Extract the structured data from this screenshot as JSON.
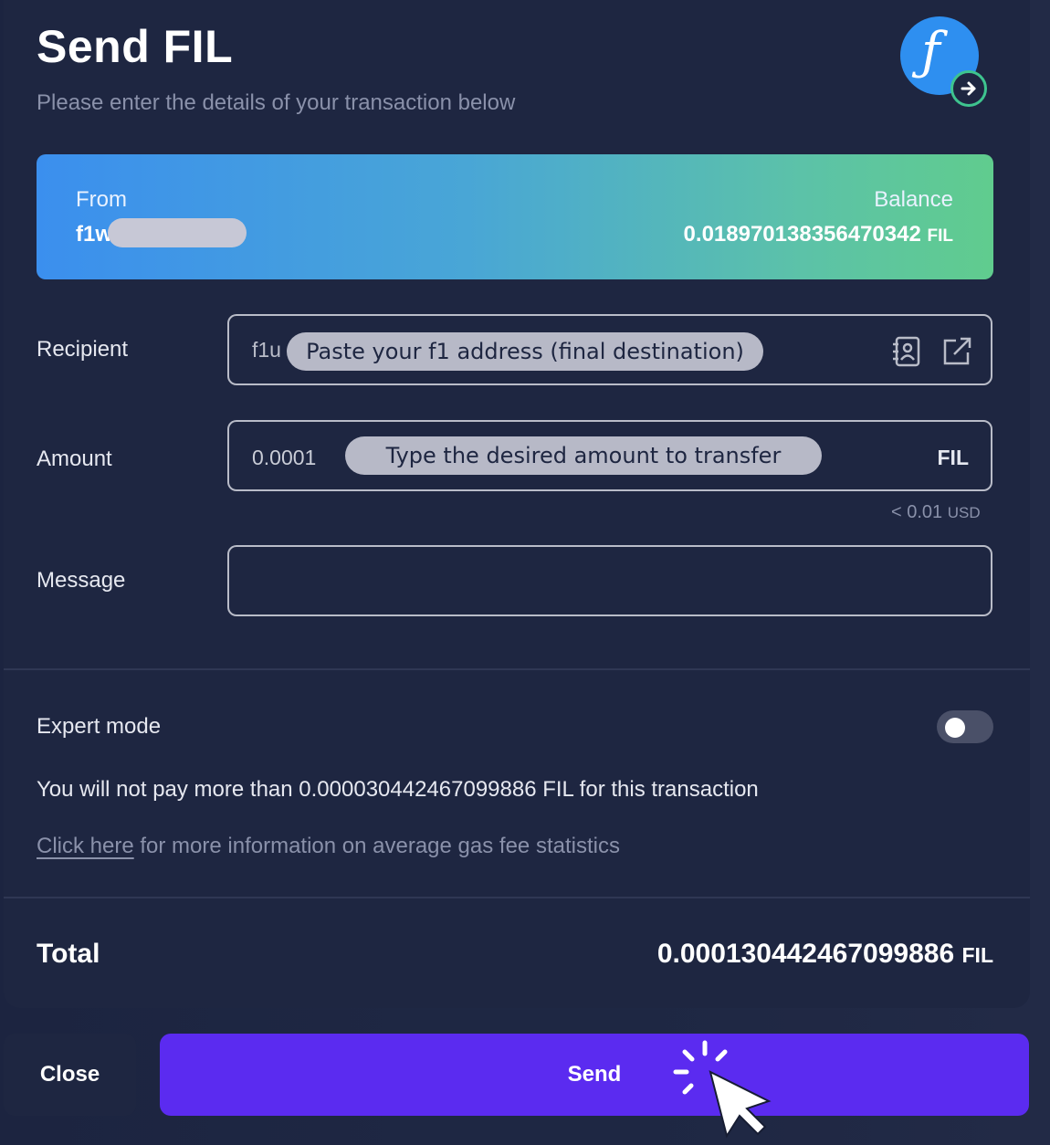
{
  "header": {
    "title": "Send FIL",
    "subtitle": "Please enter the details of your transaction below",
    "logo_icon": "filecoin-send-icon",
    "logo_glyph": "ƒ"
  },
  "from_card": {
    "from_label": "From",
    "from_address_prefix": "f1w",
    "balance_label": "Balance",
    "balance_value": "0.018970138356470342",
    "balance_unit": "FIL"
  },
  "form": {
    "recipient_label": "Recipient",
    "recipient_value_prefix": "f1u",
    "recipient_tip": "Paste your f1 address (final destination)",
    "amount_label": "Amount",
    "amount_value": "0.0001",
    "amount_tip": "Type the desired amount to transfer",
    "amount_unit": "FIL",
    "amount_usd": "< 0.01",
    "amount_usd_unit": "USD",
    "message_label": "Message",
    "message_value": ""
  },
  "expert": {
    "label": "Expert mode",
    "enabled": false,
    "note": "You will not pay more than 0.000030442467099886 FIL for this transaction",
    "link_text": "Click here",
    "link_rest": " for more information on average gas fee statistics"
  },
  "total": {
    "label": "Total",
    "value": "0.00013044246709988​6",
    "unit": "FIL"
  },
  "buttons": {
    "close": "Close",
    "send": "Send"
  },
  "colors": {
    "background": "#171d33",
    "panel": "#1e2641",
    "send_button": "#5b2bf0",
    "card_gradient_start": "#3b8fee",
    "card_gradient_end": "#60cc8e",
    "badge_ring": "#3ec48f"
  }
}
